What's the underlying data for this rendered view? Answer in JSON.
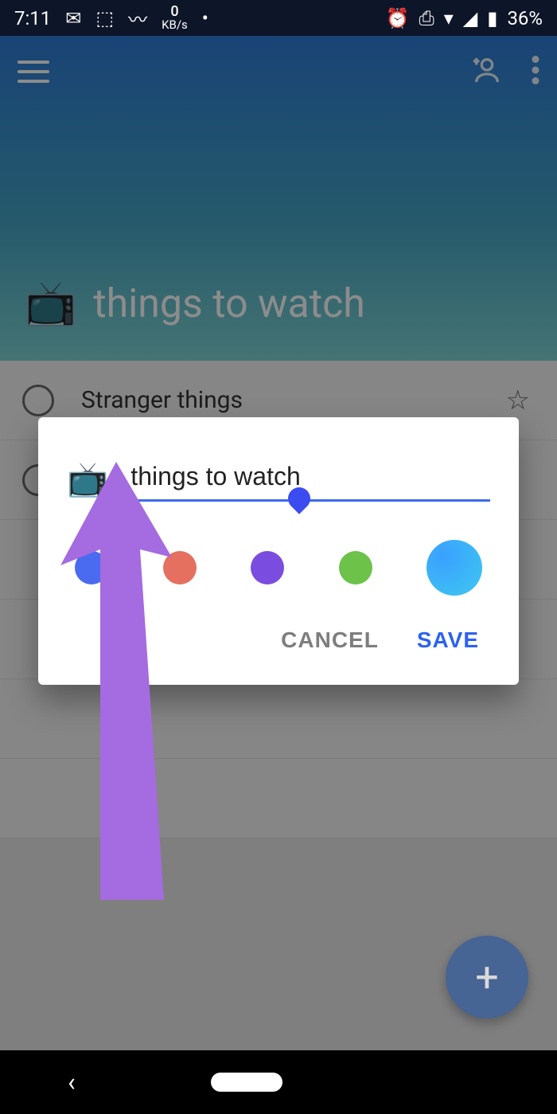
{
  "status": {
    "time": "7:11",
    "net_speed_top": "0",
    "net_speed_unit": "KB/s",
    "battery": "36%"
  },
  "header": {
    "title": "things to watch",
    "icon": "📺"
  },
  "list": {
    "items": [
      {
        "label": "Stranger things"
      }
    ]
  },
  "dialog": {
    "icon": "📺",
    "input_value": "things to watch",
    "cancel_label": "CANCEL",
    "save_label": "SAVE",
    "colors": [
      "#4a6af0",
      "#e57060",
      "#7a4de0",
      "#6dc24a",
      "#3fc8f0"
    ],
    "selected_color_index": 4
  },
  "fab": {
    "label": "+"
  }
}
